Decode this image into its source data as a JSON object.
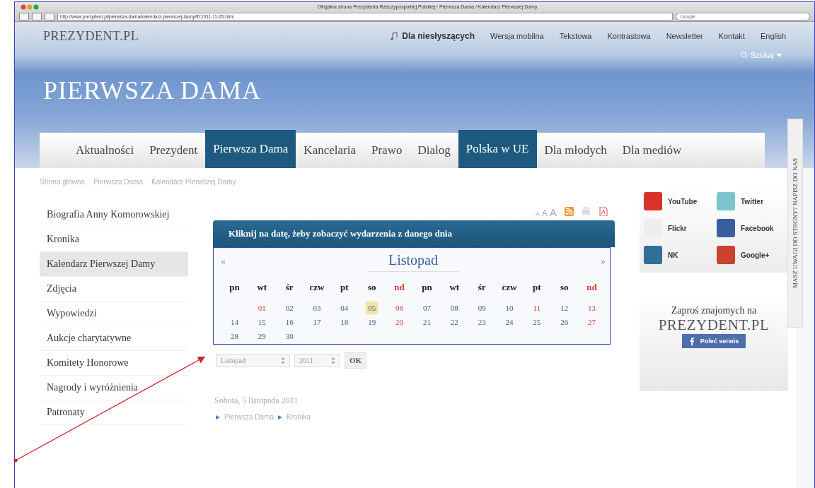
{
  "browser": {
    "title": "Oficjalna strona Prezydenta Rzeczypospolitej Polskiej / Pierwsza Dama / Kalendarz Pierwszej Damy",
    "url": "http://www.prezydent.pl/pierwsza-dama/kalendarz-pierwszej-damy/flt:2011-11-05.html",
    "search_placeholder": "Google"
  },
  "header": {
    "logo": "PREZYDENT.PL",
    "links": [
      {
        "label": "Dla niesłyszących",
        "kind": "accessibility"
      },
      {
        "label": "Wersja mobilna",
        "kind": "plain"
      },
      {
        "label": "Tekstowa",
        "kind": "plain"
      },
      {
        "label": "Kontrastowa",
        "kind": "plain"
      },
      {
        "label": "Newsletter",
        "kind": "plain"
      },
      {
        "label": "Kontakt",
        "kind": "plain"
      },
      {
        "label": "English",
        "kind": "plain"
      }
    ],
    "search": "Szukaj",
    "page_title": "PIERWSZA DAMA"
  },
  "nav": [
    {
      "label": "Aktualności",
      "selected": false
    },
    {
      "label": "Prezydent",
      "selected": false
    },
    {
      "label": "Pierwsza Dama",
      "selected": true
    },
    {
      "label": "Kancelaria",
      "selected": false
    },
    {
      "label": "Prawo",
      "selected": false
    },
    {
      "label": "Dialog",
      "selected": false
    },
    {
      "label": "Polska w UE",
      "selected": true
    },
    {
      "label": "Dla młodych",
      "selected": false
    },
    {
      "label": "Dla mediów",
      "selected": false
    }
  ],
  "breadcrumb": [
    "Strona główna",
    "Pierwsza Dama",
    "Kalendarz Pierwszej Damy"
  ],
  "sidebar": {
    "items": [
      {
        "label": "Biografia Anny Komorowskiej",
        "selected": false
      },
      {
        "label": "Kronika",
        "selected": false
      },
      {
        "label": "Kalendarz Pierwszej Damy",
        "selected": true
      },
      {
        "label": "Zdjęcia",
        "selected": false
      },
      {
        "label": "Wypowiedzi",
        "selected": false
      },
      {
        "label": "Aukcje charytatywne",
        "selected": false
      },
      {
        "label": "Komitety Honorowe",
        "selected": false
      },
      {
        "label": "Nagrody i wyróżnienia",
        "selected": false
      },
      {
        "label": "Patronaty",
        "selected": false
      }
    ]
  },
  "text_size": [
    "A",
    "A",
    "A"
  ],
  "calendar": {
    "heading": "Kliknij na datę, żeby zobaczyć wydarzenia z danego dnia",
    "prev": "«",
    "next": "»",
    "month": "Listopad",
    "weekdays": [
      {
        "label": "pn",
        "sunday": false
      },
      {
        "label": "wt",
        "sunday": false
      },
      {
        "label": "śr",
        "sunday": false
      },
      {
        "label": "czw",
        "sunday": false
      },
      {
        "label": "pt",
        "sunday": false
      },
      {
        "label": "so",
        "sunday": false
      },
      {
        "label": "nd",
        "sunday": true
      },
      {
        "label": "pn",
        "sunday": false
      },
      {
        "label": "wt",
        "sunday": false
      },
      {
        "label": "śr",
        "sunday": false
      },
      {
        "label": "czw",
        "sunday": false
      },
      {
        "label": "pt",
        "sunday": false
      },
      {
        "label": "so",
        "sunday": false
      },
      {
        "label": "nd",
        "sunday": true
      }
    ],
    "days": [
      {
        "label": "01",
        "holiday": true,
        "selected": false
      },
      {
        "label": "02",
        "holiday": false,
        "selected": false
      },
      {
        "label": "03",
        "holiday": false,
        "selected": false
      },
      {
        "label": "04",
        "holiday": false,
        "selected": false
      },
      {
        "label": "05",
        "holiday": false,
        "selected": true
      },
      {
        "label": "06",
        "holiday": true,
        "selected": false
      },
      {
        "label": "07",
        "holiday": false,
        "selected": false
      },
      {
        "label": "08",
        "holiday": false,
        "selected": false
      },
      {
        "label": "09",
        "holiday": false,
        "selected": false
      },
      {
        "label": "10",
        "holiday": false,
        "selected": false
      },
      {
        "label": "11",
        "holiday": true,
        "selected": false
      },
      {
        "label": "12",
        "holiday": false,
        "selected": false
      },
      {
        "label": "13",
        "holiday": true,
        "selected": false
      },
      {
        "label": "14",
        "holiday": false,
        "selected": false
      },
      {
        "label": "15",
        "holiday": false,
        "selected": false
      },
      {
        "label": "16",
        "holiday": false,
        "selected": false
      },
      {
        "label": "17",
        "holiday": false,
        "selected": false
      },
      {
        "label": "18",
        "holiday": false,
        "selected": false
      },
      {
        "label": "19",
        "holiday": false,
        "selected": false
      },
      {
        "label": "20",
        "holiday": true,
        "selected": false
      },
      {
        "label": "21",
        "holiday": false,
        "selected": false
      },
      {
        "label": "22",
        "holiday": false,
        "selected": false
      },
      {
        "label": "23",
        "holiday": false,
        "selected": false
      },
      {
        "label": "24",
        "holiday": false,
        "selected": false
      },
      {
        "label": "25",
        "holiday": false,
        "selected": false
      },
      {
        "label": "26",
        "holiday": false,
        "selected": false
      },
      {
        "label": "27",
        "holiday": true,
        "selected": false
      },
      {
        "label": "28",
        "holiday": false,
        "selected": false
      },
      {
        "label": "29",
        "holiday": false,
        "selected": false
      },
      {
        "label": "30",
        "holiday": false,
        "selected": false
      }
    ],
    "month_select": "Listopad",
    "year_select": "2011",
    "ok": "OK"
  },
  "selected_date": "Sobota, 5 listopada 2011",
  "date_breadcrumb": [
    "Pierwsza Dama",
    "Kronika"
  ],
  "social": [
    {
      "label": "YouTube",
      "color": "#d8322a"
    },
    {
      "label": "Twitter",
      "color": "#7cc4cc"
    },
    {
      "label": "Flickr",
      "color": "#eeeeee"
    },
    {
      "label": "Facebook",
      "color": "#3b5e9e"
    },
    {
      "label": "NK",
      "color": "#2f6f98"
    },
    {
      "label": "Google+",
      "color": "#c9432f"
    }
  ],
  "invite": {
    "text": "Zaproś znajomych na",
    "logo": "PREZYDENT.PL",
    "button": "Poleć serwis"
  },
  "feedback_tab": "MASZ UWAGI DO STRONY? NAPISZ DO NAS"
}
